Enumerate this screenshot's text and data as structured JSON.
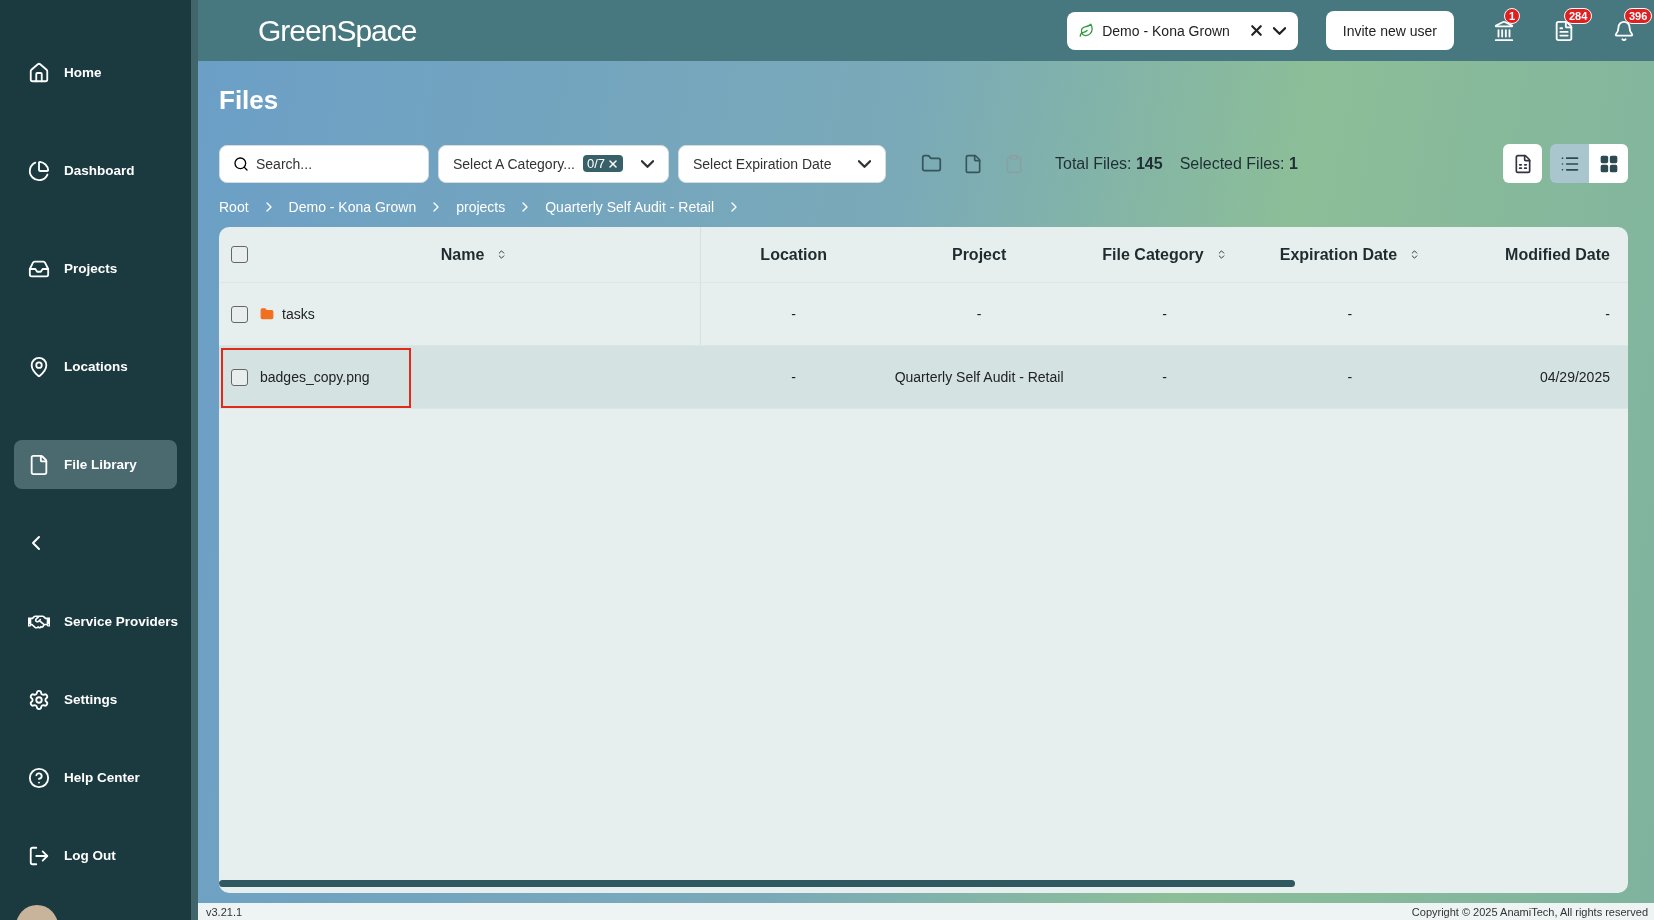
{
  "sidebar": {
    "items": [
      {
        "label": "Home",
        "selected": false
      },
      {
        "label": "Dashboard",
        "selected": false
      },
      {
        "label": "Projects",
        "selected": false
      },
      {
        "label": "Locations",
        "selected": false
      },
      {
        "label": "File Library",
        "selected": true
      }
    ],
    "bottom_items": [
      {
        "label": "Service Providers",
        "selected": false
      },
      {
        "label": "Settings",
        "selected": false
      },
      {
        "label": "Help Center",
        "selected": false
      },
      {
        "label": "Log Out",
        "selected": false
      }
    ]
  },
  "topbar": {
    "logo": "GreenSpace",
    "organization": "Demo - Kona Grown",
    "invite_button": "Invite new user",
    "badges": [
      "1",
      "284",
      "396"
    ]
  },
  "page": {
    "title": "Files"
  },
  "toolbar": {
    "search": {
      "placeholder": "Search..."
    },
    "category": {
      "placeholder": "Select A Category...",
      "count": "0/7"
    },
    "expiration": {
      "placeholder": "Select Expiration Date"
    },
    "total_label": "Total Files:",
    "total": "145",
    "selected_label": "Selected Files:",
    "selected": "1",
    "views": [
      {
        "selected": true
      },
      {
        "selected": false
      }
    ]
  },
  "breadcrumb": [
    "Root",
    "Demo - Kona Grown",
    "projects",
    "Quarterly Self Audit - Retail"
  ],
  "table": {
    "columns": [
      {
        "label": "Name",
        "sortable": true
      },
      {
        "label": "Location",
        "sortable": false
      },
      {
        "label": "Project",
        "sortable": false
      },
      {
        "label": "File Category",
        "sortable": true
      },
      {
        "label": "Expiration Date",
        "sortable": true
      },
      {
        "label": "Modified Date",
        "sortable": false
      }
    ],
    "select_all": {
      "checked": false
    },
    "rows": [
      {
        "kind": "folder",
        "cells": [
          "tasks",
          "-",
          "-",
          "-",
          "-",
          "-"
        ],
        "checked": false,
        "selected": false,
        "highlighted": false
      },
      {
        "kind": "file",
        "cells": [
          "badges_copy.png",
          "-",
          "Quarterly Self Audit - Retail",
          "-",
          "-",
          "04/29/2025"
        ],
        "checked": false,
        "selected": true,
        "highlighted": true
      }
    ]
  },
  "footer": {
    "version": "v3.21.1",
    "copyright": "Copyright © 2025 AnamiTech, All rights reserved"
  }
}
